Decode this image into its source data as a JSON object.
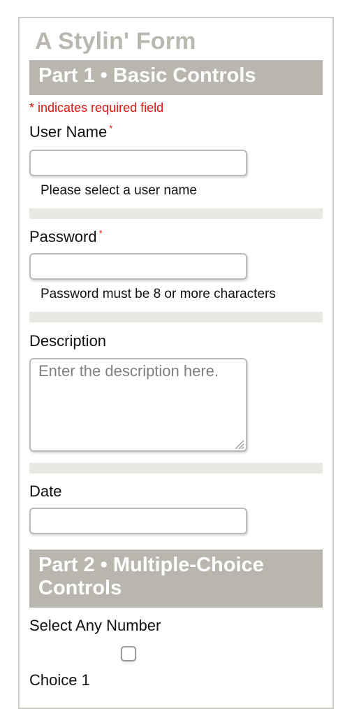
{
  "form": {
    "title": "A Stylin' Form"
  },
  "part1": {
    "heading": "Part 1 • Basic Controls",
    "required_note": "* indicates required field",
    "username": {
      "label": "User Name",
      "required_marker": "*",
      "value": "",
      "hint": "Please select a user name"
    },
    "password": {
      "label": "Password",
      "required_marker": "*",
      "value": "",
      "hint": "Password must be 8 or more characters"
    },
    "description": {
      "label": "Description",
      "placeholder": "Enter the description here.",
      "value": ""
    },
    "date": {
      "label": "Date",
      "value": ""
    }
  },
  "part2": {
    "heading": "Part 2 • Multiple-Choice Controls",
    "group_label": "Select Any Number",
    "choices": [
      {
        "label": "Choice 1",
        "checked": false
      }
    ]
  },
  "colors": {
    "header_bg": "#b9b6af",
    "title_text": "#bab7b0",
    "required_red": "#e0120e",
    "divider": "#e8e7e2"
  }
}
